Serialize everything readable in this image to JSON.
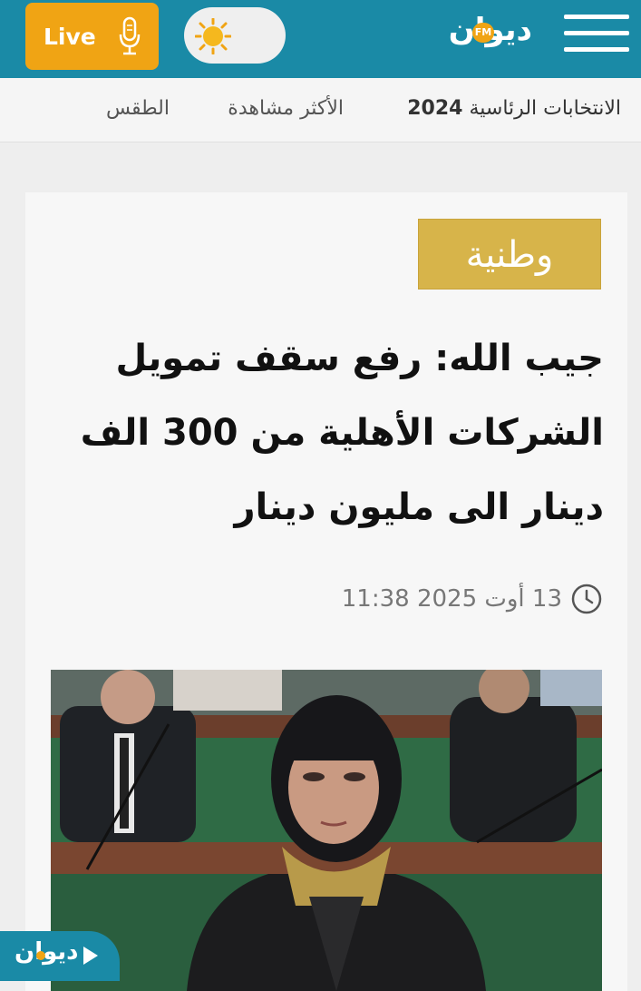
{
  "header": {
    "live_label": "Live",
    "logo_text": "ديوان",
    "logo_badge": "FM",
    "colors": {
      "bar": "#1a8aa6",
      "live": "#f0a414"
    }
  },
  "nav": {
    "items": [
      {
        "label": "الانتخابات الرئاسية",
        "number": "2024"
      },
      {
        "label": "الأكثر مشاهدة"
      },
      {
        "label": "الطقس"
      }
    ]
  },
  "article": {
    "category": "وطنية",
    "headline_lines": [
      "جيب الله: رفع سقف تمويل",
      "الشركات الأهلية من 300 الف",
      "دينار الى مليون دينار"
    ],
    "date": "13 أوت 2025 11:38",
    "image_icon": "news-photo"
  },
  "player": {
    "logo_text": "ديوان"
  }
}
